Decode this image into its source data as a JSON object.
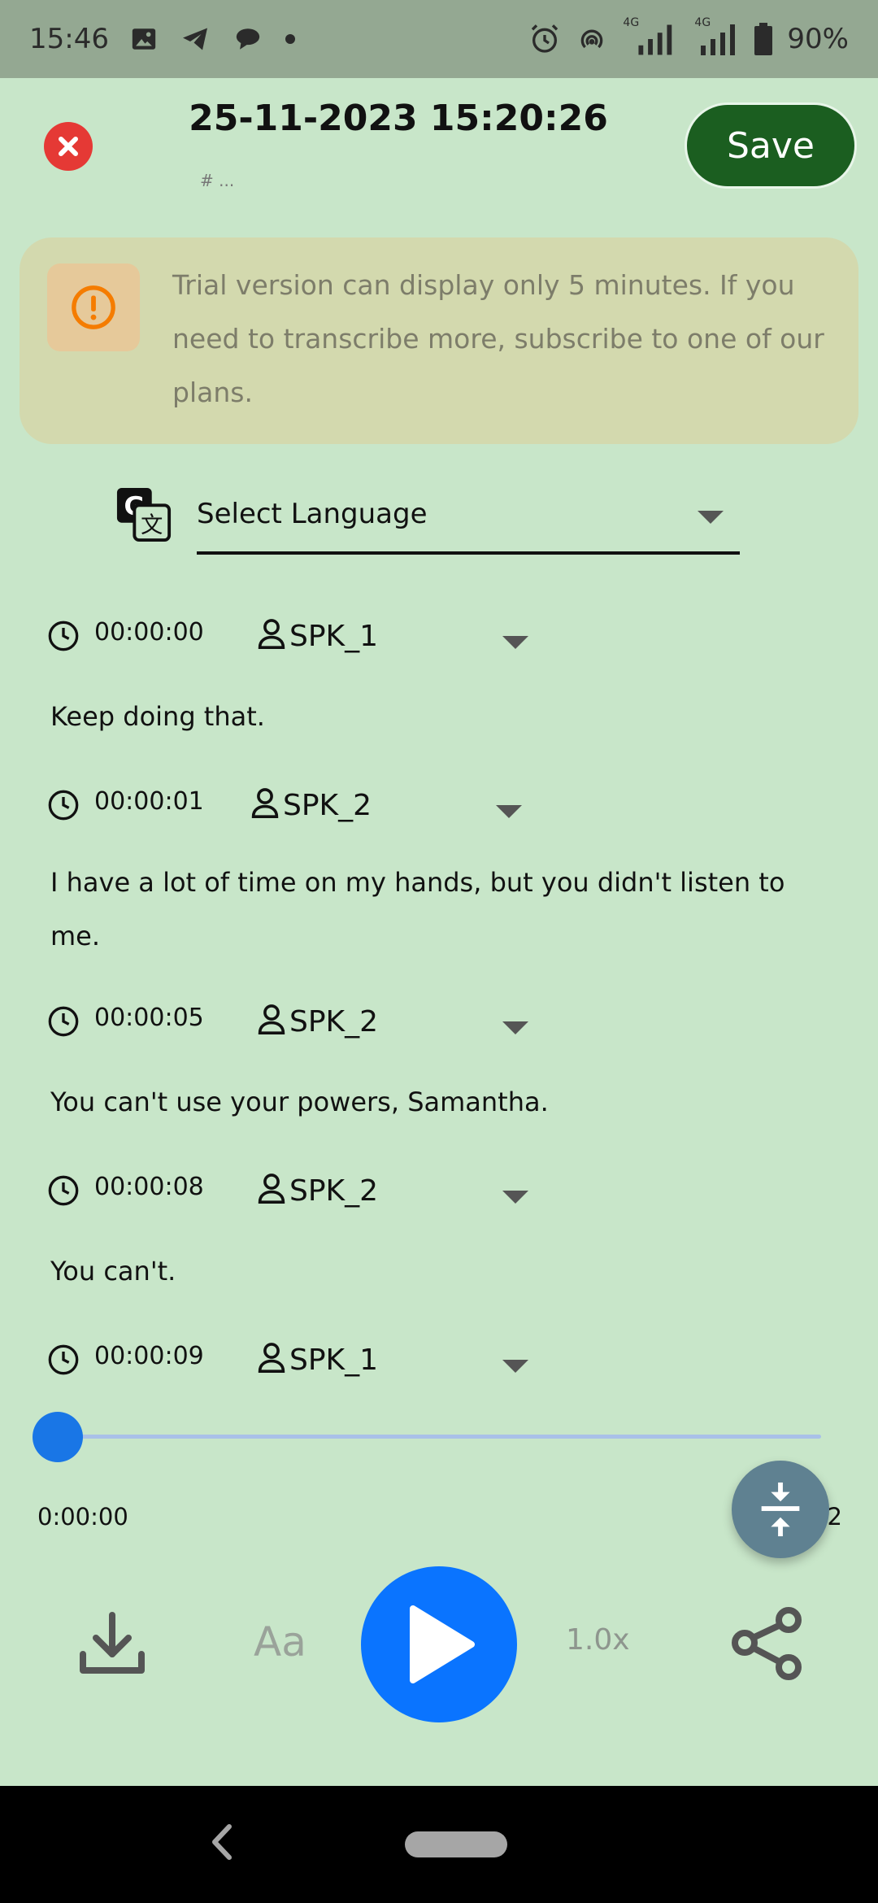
{
  "status_bar": {
    "time": "15:46",
    "network_label_1": "4G",
    "network_label_2": "4G",
    "battery": "90%"
  },
  "header": {
    "title": "25-11-2023 15:20:26",
    "subtitle": "# ...",
    "save_label": "Save",
    "close_icon": "close-icon"
  },
  "banner": {
    "text": "Trial version can display only 5 minutes. If you need to transcribe more, subscribe to one of our plans.",
    "icon": "warning-icon",
    "accent_color": "#f57c00"
  },
  "language": {
    "label": "Select Language",
    "icon": "translate-icon"
  },
  "segments": [
    {
      "time": "00:00:00",
      "speaker": "SPK_1",
      "text": "Keep doing that."
    },
    {
      "time": "00:00:01",
      "speaker": "SPK_2",
      "text": "I have a lot of time on my hands, but you didn't listen to me."
    },
    {
      "time": "00:00:05",
      "speaker": "SPK_2",
      "text": "You can't use your powers, Samantha."
    },
    {
      "time": "00:00:08",
      "speaker": "SPK_2",
      "text": "You can't."
    },
    {
      "time": "00:00:09",
      "speaker": "SPK_1",
      "text": ""
    }
  ],
  "player": {
    "current_time": "0:00:00",
    "total_time_visible": "2",
    "progress": 0,
    "font_label": "Aa",
    "speed_label": "1.0x",
    "accent_color": "#0a74ff"
  }
}
